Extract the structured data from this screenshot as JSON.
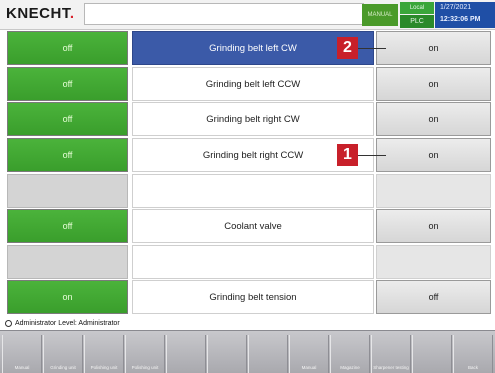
{
  "header": {
    "logo": "KNECHT",
    "mode": "MANUAL",
    "local_label": "Local",
    "plc_label": "PLC",
    "date": "1/27/2021",
    "time": "12:32:06 PM"
  },
  "rows": [
    {
      "state": "off",
      "label": "Grinding belt left CW",
      "action": "on",
      "selected": true
    },
    {
      "state": "off",
      "label": "Grinding belt left CCW",
      "action": "on"
    },
    {
      "state": "off",
      "label": "Grinding belt right CW",
      "action": "on"
    },
    {
      "state": "off",
      "label": "Grinding belt right CCW",
      "action": "on"
    },
    {
      "state": "",
      "label": "",
      "action": ""
    },
    {
      "state": "off",
      "label": "Coolant valve",
      "action": "on"
    },
    {
      "state": "",
      "label": "",
      "action": ""
    },
    {
      "state": "on",
      "label": "Grinding belt tension",
      "action": "off"
    }
  ],
  "callouts": {
    "first": "1",
    "second": "2"
  },
  "status": {
    "user": "Administrator",
    "level": "Level: Administrator"
  },
  "toolbar": {
    "keys": [
      {
        "label": "Manual"
      },
      {
        "label": "Grinding unit"
      },
      {
        "label": "Polishing unit"
      },
      {
        "label": "Polishing unit"
      },
      {
        "label": ""
      },
      {
        "label": ""
      },
      {
        "label": ""
      },
      {
        "label": "Manual"
      },
      {
        "label": "Magazine"
      },
      {
        "label": "Sharpener testing"
      },
      {
        "label": ""
      },
      {
        "label": "Back"
      }
    ]
  },
  "colors": {
    "accent": "#3b5aa8",
    "on_green": "#3fa52f",
    "callout_red": "#c8202a"
  }
}
